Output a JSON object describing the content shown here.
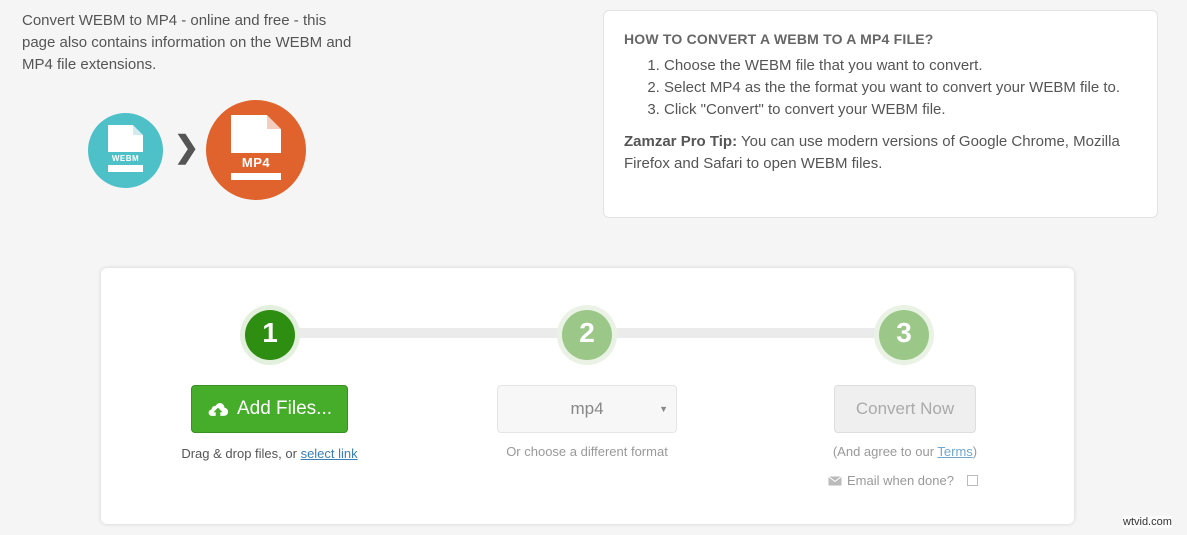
{
  "intro": {
    "text": "Convert WEBM to MP4 - online and free - this page also contains information on the WEBM and MP4 file extensions."
  },
  "icons": {
    "source_label": "WEBM",
    "target_label": "MP4",
    "arrow": "❯",
    "source_color": "#4ec0c7",
    "target_color": "#e0622c"
  },
  "howto": {
    "title": "HOW TO CONVERT A WEBM TO A MP4 FILE?",
    "steps": [
      "Choose the WEBM file that you want to convert.",
      "Select MP4 as the the format you want to convert your WEBM file to.",
      "Click \"Convert\" to convert your WEBM file."
    ],
    "tip_label": "Zamzar Pro Tip:",
    "tip_text": " You can use modern versions of Google Chrome, Mozilla Firefox and Safari to open WEBM files."
  },
  "converter": {
    "steps": [
      "1",
      "2",
      "3"
    ],
    "add_files_label": "Add Files...",
    "drag_text": "Drag & drop files, or ",
    "select_link": "select link",
    "format_value": "mp4",
    "format_caret": "▼",
    "format_hint": "Or choose a different format",
    "convert_label": "Convert Now",
    "terms_prefix": "(And agree to our ",
    "terms_link": "Terms",
    "terms_suffix": ")",
    "email_label": "Email when done?",
    "accent_green": "#46ad2a",
    "step_active_color": "#2e8e12",
    "step_inactive_color": "#9bc888"
  },
  "watermark": "wtvid.com"
}
